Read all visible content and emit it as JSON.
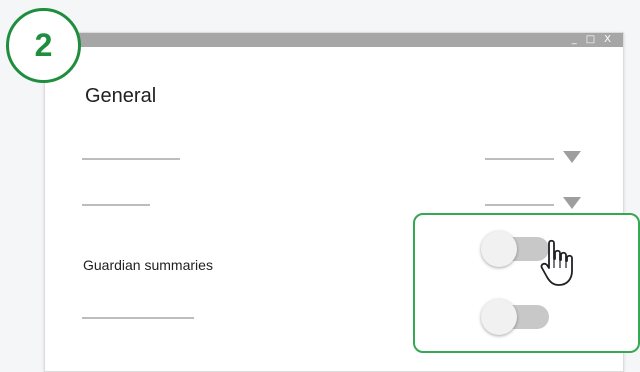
{
  "step_badge": {
    "number": "2"
  },
  "window": {
    "controls": {
      "minimize": "_",
      "maximize": "□",
      "close": "X"
    },
    "section_title": "General",
    "settings": [
      {
        "label": "Guardian summaries"
      }
    ]
  },
  "callout": {
    "toggles": [
      {
        "name": "toggle-on-hover",
        "state": "off"
      },
      {
        "name": "toggle-second",
        "state": "off"
      }
    ],
    "cursor_icon": "pointer-hand-icon"
  },
  "colors": {
    "badge_green": "#1e8e3e",
    "callout_border": "#34a853",
    "titlebar": "#a6a6a6",
    "toggle_track": "#c8c8c8"
  }
}
